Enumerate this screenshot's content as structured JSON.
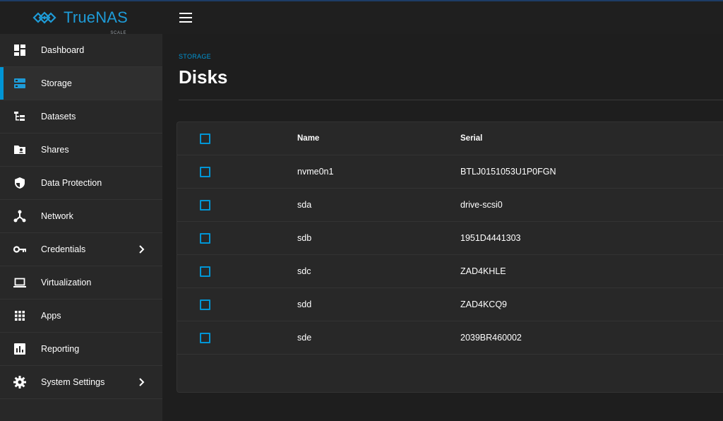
{
  "app": {
    "logo_text": "TrueNAS",
    "logo_sub": "SCALE",
    "accent_color": "#0095d5"
  },
  "sidebar": {
    "items": [
      {
        "label": "Dashboard",
        "icon": "dashboard-icon"
      },
      {
        "label": "Storage",
        "icon": "storage-icon",
        "active": true
      },
      {
        "label": "Datasets",
        "icon": "datasets-icon"
      },
      {
        "label": "Shares",
        "icon": "shares-icon"
      },
      {
        "label": "Data Protection",
        "icon": "shield-icon"
      },
      {
        "label": "Network",
        "icon": "network-icon"
      },
      {
        "label": "Credentials",
        "icon": "key-icon",
        "has_submenu": true
      },
      {
        "label": "Virtualization",
        "icon": "laptop-icon"
      },
      {
        "label": "Apps",
        "icon": "apps-grid-icon"
      },
      {
        "label": "Reporting",
        "icon": "bar-chart-icon"
      },
      {
        "label": "System Settings",
        "icon": "gear-icon",
        "has_submenu": true
      }
    ]
  },
  "header": {
    "menu_icon": "hamburger-menu-icon"
  },
  "main": {
    "breadcrumb": "STORAGE",
    "title": "Disks",
    "table": {
      "columns": [
        "Name",
        "Serial"
      ],
      "rows": [
        {
          "name": "nvme0n1",
          "serial": "BTLJ0151053U1P0FGN"
        },
        {
          "name": "sda",
          "serial": "drive-scsi0"
        },
        {
          "name": "sdb",
          "serial": "1951D4441303"
        },
        {
          "name": "sdc",
          "serial": "ZAD4KHLE"
        },
        {
          "name": "sdd",
          "serial": "ZAD4KCQ9"
        },
        {
          "name": "sde",
          "serial": "2039BR460002"
        }
      ]
    }
  }
}
